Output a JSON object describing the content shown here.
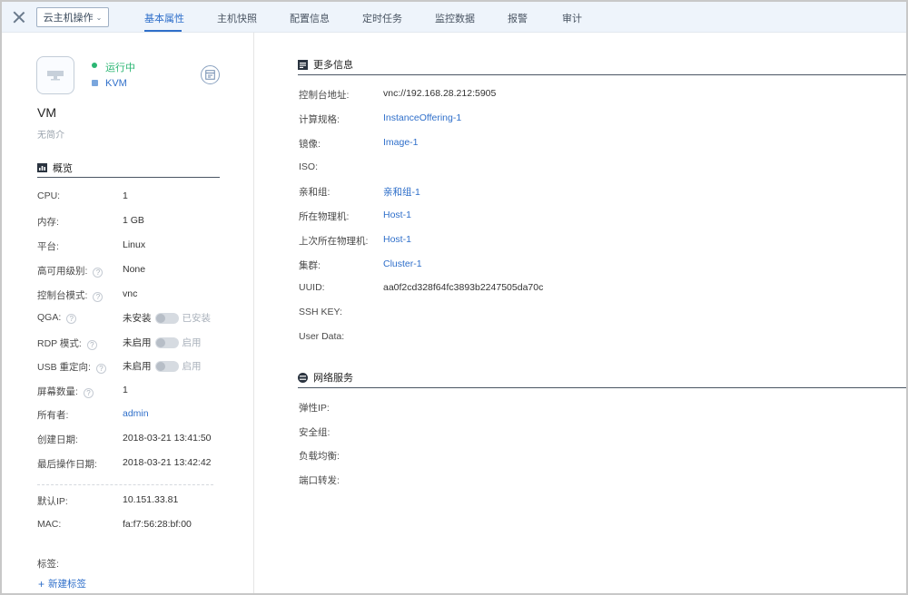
{
  "topbar": {
    "ops_button": "云主机操作",
    "tabs": [
      "基本属性",
      "主机快照",
      "配置信息",
      "定时任务",
      "监控数据",
      "报警",
      "审计"
    ]
  },
  "vm": {
    "status": "运行中",
    "hypervisor": "KVM",
    "name": "VM",
    "description": "无简介"
  },
  "overview": {
    "title": "概览",
    "rows": [
      {
        "label": "CPU:",
        "value": "1"
      },
      {
        "label": "内存:",
        "value": "1 GB"
      },
      {
        "label": "平台:",
        "value": "Linux"
      },
      {
        "label": "高可用级别:",
        "value": "None"
      },
      {
        "label": "控制台模式:",
        "value": "vnc"
      },
      {
        "label": "QGA:",
        "value_off": "未安装",
        "value_on": "已安装"
      },
      {
        "label": "RDP 模式:",
        "value_off": "未启用",
        "value_on": "启用"
      },
      {
        "label": "USB 重定向:",
        "value_off": "未启用",
        "value_on": "启用"
      },
      {
        "label": "屏幕数量:",
        "value": "1"
      },
      {
        "label": "所有者:",
        "value": "admin"
      },
      {
        "label": "创建日期:",
        "value": "2018-03-21 13:41:50"
      },
      {
        "label": "最后操作日期:",
        "value": "2018-03-21 13:42:42"
      }
    ],
    "help_icon": "?",
    "default_ip_label": "默认IP:",
    "default_ip": "10.151.33.81",
    "mac_label": "MAC:",
    "mac": "fa:f7:56:28:bf:00",
    "tags_label": "标签:",
    "new_tag": "新建标签"
  },
  "more_info": {
    "title": "更多信息",
    "rows": [
      {
        "label": "控制台地址:",
        "value": "vnc://192.168.28.212:5905"
      },
      {
        "label": "计算规格:",
        "value": "InstanceOffering-1"
      },
      {
        "label": "镜像:",
        "value": "Image-1"
      },
      {
        "label": "ISO:",
        "value": ""
      },
      {
        "label": "亲和组:",
        "value": "亲和组-1"
      },
      {
        "label": "所在物理机:",
        "value": "Host-1"
      },
      {
        "label": "上次所在物理机:",
        "value": "Host-1"
      },
      {
        "label": "集群:",
        "value": "Cluster-1"
      },
      {
        "label": "UUID:",
        "value": "aa0f2cd328f64fc3893b2247505da70c"
      },
      {
        "label": "SSH KEY:",
        "value": ""
      },
      {
        "label": "User Data:",
        "value": ""
      }
    ]
  },
  "network": {
    "title": "网络服务",
    "rows": [
      {
        "label": "弹性IP:"
      },
      {
        "label": "安全组:"
      },
      {
        "label": "负载均衡:"
      },
      {
        "label": "端口转发:"
      }
    ]
  },
  "colors": {
    "accent": "#2f6fca",
    "running": "#2bb673",
    "topbar_bg": "#eef4fb"
  }
}
